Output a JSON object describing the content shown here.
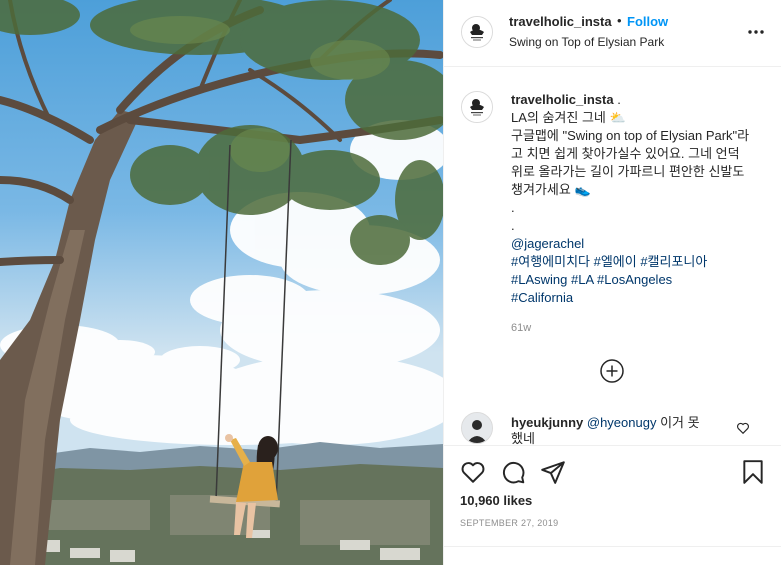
{
  "post": {
    "username": "travelholic_insta",
    "follow_separator": "•",
    "follow_label": "Follow",
    "location": "Swing on Top of Elysian Park",
    "more_icon": "more-horizontal-icon"
  },
  "caption": {
    "username": "travelholic_insta",
    "dot": ".",
    "line1": "LA의 숨겨진 그네",
    "line1_emoji": "⛅",
    "line2": "구글맵에 \"Swing on top of Elysian Park\"라고 치면 쉽게 찾아가실수 있어요. 그네 언덕위로 올라가는 길이 가파르니 편안한 신발도 챙겨가세요",
    "line2_emoji": "👟",
    "dot1": ".",
    "dot2": ".",
    "mention": "@jagerachel",
    "tags_line1": "#여행에미치다 #엘에이 #캘리포니아",
    "tags_line2": "#LAswing #LA #LosAngeles",
    "tags_line3": "#California",
    "time": "61w"
  },
  "load_more_icon": "plus-circle-icon",
  "comment": {
    "username": "hyeukjunny",
    "mention": "@hyeonugy",
    "text": "이거 못",
    "text_cont": "했네"
  },
  "actions": {
    "like_icon": "heart-icon",
    "comment_icon": "comment-icon",
    "share_icon": "share-icon",
    "save_icon": "bookmark-icon"
  },
  "likes": "10,960 likes",
  "date": "SEPTEMBER 27, 2019",
  "colors": {
    "link": "#00376b",
    "follow": "#0095f6",
    "border": "#efefef",
    "muted": "#8e8e8e"
  }
}
